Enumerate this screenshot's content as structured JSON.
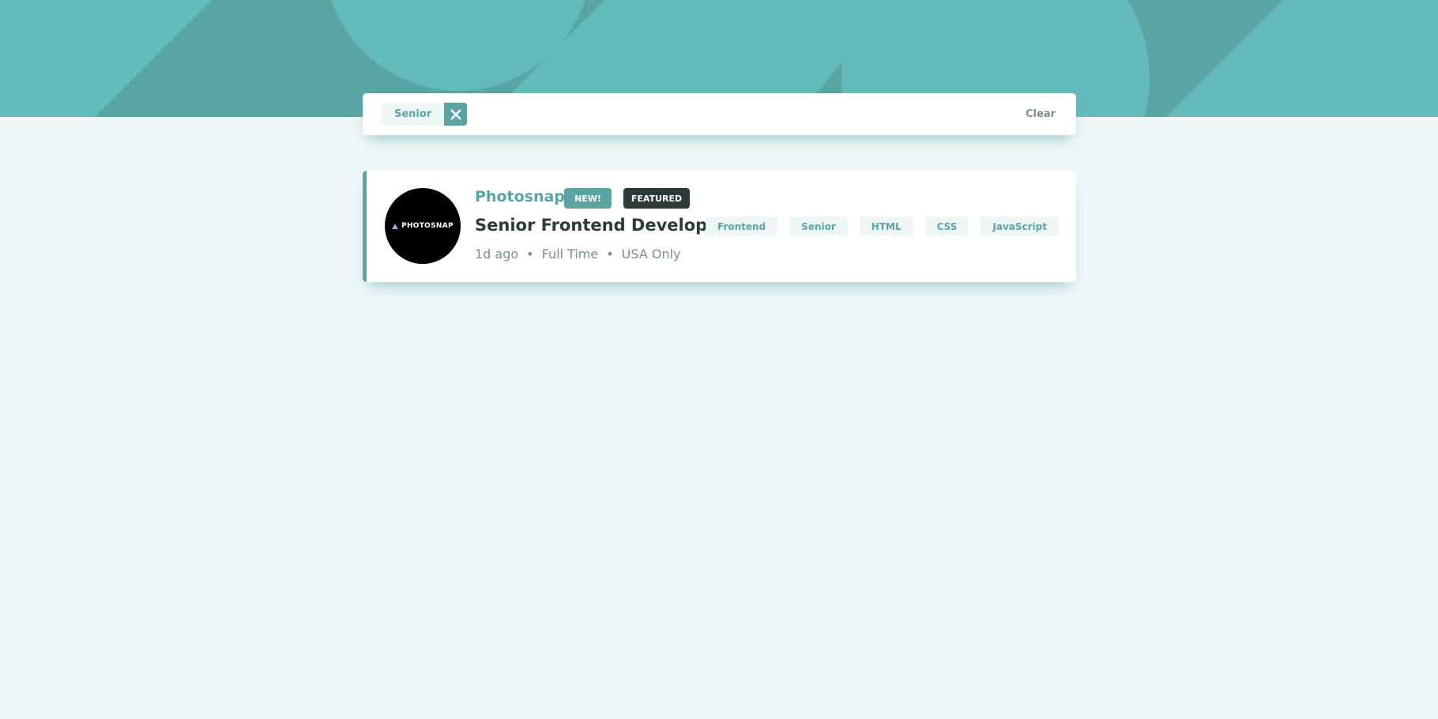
{
  "colors": {
    "primary": "#5ba4a4",
    "header_bg": "#63babb",
    "page_bg": "#eff7f8",
    "tag_bg": "#eef6f6",
    "dark": "#2c3a3a",
    "muted": "#7b8e8e"
  },
  "filter_bar": {
    "active_filters": [
      {
        "label": "Senior",
        "remove_icon": "close-icon"
      }
    ],
    "clear_label": "Clear"
  },
  "jobs": [
    {
      "logo_text": "PHOTOSNAP",
      "company": "Photosnap",
      "badges": {
        "new": "NEW!",
        "featured": "FEATURED"
      },
      "position": "Senior Frontend Developer",
      "posted": "1d ago",
      "contract": "Full Time",
      "location": "USA Only",
      "separator": "•",
      "tags": [
        "Frontend",
        "Senior",
        "HTML",
        "CSS",
        "JavaScript"
      ]
    }
  ]
}
